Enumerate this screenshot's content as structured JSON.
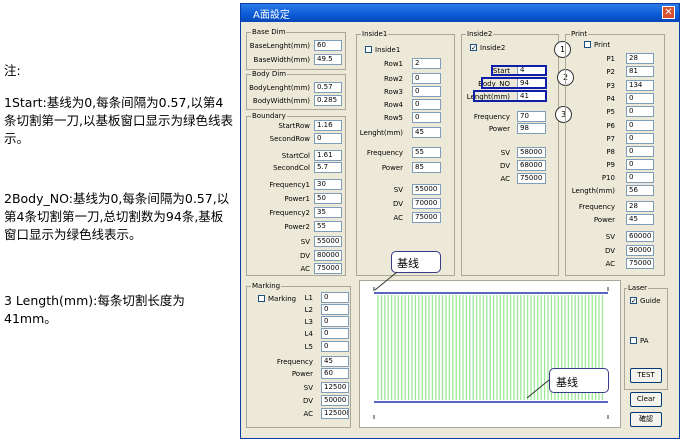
{
  "note": {
    "title": "注:",
    "p1": "1Start:基线为0,每条间隔为0.57,以第4条切割第一刀,以基板窗口显示为绿色线表示。",
    "p2": "2Body_NO:基线为0,每条间隔为0.57,以第4条切割第一刀,总切割数为94条,基板窗口显示为绿色线表示。",
    "p3": "3 Length(mm):每条切割长度为41mm。"
  },
  "window": {
    "title": "A面設定",
    "close": "✕"
  },
  "base_dim": {
    "title": "Base Dim",
    "rows": [
      {
        "label": "BaseLenght(mm)",
        "value": "60"
      },
      {
        "label": "BaseWidth(mm)",
        "value": "49.5"
      }
    ]
  },
  "body_dim": {
    "title": "Body Dim",
    "rows": [
      {
        "label": "BodyLenght(mm)",
        "value": "0.57"
      },
      {
        "label": "BodyWidth(mm)",
        "value": "0.285"
      }
    ]
  },
  "boundary": {
    "title": "Boundary",
    "rows": [
      {
        "label": "StartRow",
        "value": "1.16"
      },
      {
        "label": "SecondRow",
        "value": "0"
      },
      {
        "label": "StartCol",
        "value": "1.61"
      },
      {
        "label": "SecondCol",
        "value": "5.7"
      },
      {
        "label": "Frequency1",
        "value": "30"
      },
      {
        "label": "Power1",
        "value": "50"
      },
      {
        "label": "Frequency2",
        "value": "35"
      },
      {
        "label": "Power2",
        "value": "55"
      },
      {
        "label": "SV",
        "value": "55000"
      },
      {
        "label": "DV",
        "value": "80000"
      },
      {
        "label": "AC",
        "value": "75000"
      }
    ]
  },
  "inside1": {
    "title": "Inside1",
    "check_label": "Inside1",
    "checked": "",
    "rows": [
      {
        "label": "Row1",
        "value": "2"
      },
      {
        "label": "Row2",
        "value": "0"
      },
      {
        "label": "Row3",
        "value": "0"
      },
      {
        "label": "Row4",
        "value": "0"
      },
      {
        "label": "Row5",
        "value": "0"
      },
      {
        "label": "Lenght(mm)",
        "value": "45"
      },
      {
        "label": "Frequency",
        "value": "55"
      },
      {
        "label": "Power",
        "value": "85"
      },
      {
        "label": "SV",
        "value": "55000"
      },
      {
        "label": "DV",
        "value": "70000"
      },
      {
        "label": "AC",
        "value": "75000"
      }
    ]
  },
  "inside2": {
    "title": "Inside2",
    "check_label": "Inside2",
    "checked": "✓",
    "rows": [
      {
        "label": "Start",
        "value": "4"
      },
      {
        "label": "Body_NO",
        "value": "94"
      },
      {
        "label": "Lenght(mm)",
        "value": "41"
      },
      {
        "label": "Frequency",
        "value": "70"
      },
      {
        "label": "Power",
        "value": "98"
      },
      {
        "label": "SV",
        "value": "58000"
      },
      {
        "label": "DV",
        "value": "68000"
      },
      {
        "label": "AC",
        "value": "75000"
      }
    ],
    "markers": [
      "1",
      "2",
      "3"
    ]
  },
  "print": {
    "title": "Print",
    "check_label": "Print",
    "checked": "",
    "rows": [
      {
        "label": "P1",
        "value": "28"
      },
      {
        "label": "P2",
        "value": "81"
      },
      {
        "label": "P3",
        "value": "134"
      },
      {
        "label": "P4",
        "value": "0"
      },
      {
        "label": "P5",
        "value": "0"
      },
      {
        "label": "P6",
        "value": "0"
      },
      {
        "label": "P7",
        "value": "0"
      },
      {
        "label": "P8",
        "value": "0"
      },
      {
        "label": "P9",
        "value": "0"
      },
      {
        "label": "P10",
        "value": "0"
      },
      {
        "label": "Length(mm)",
        "value": "56"
      },
      {
        "label": "Frequency",
        "value": "28"
      },
      {
        "label": "Power",
        "value": "45"
      },
      {
        "label": "SV",
        "value": "60000"
      },
      {
        "label": "DV",
        "value": "90000"
      },
      {
        "label": "AC",
        "value": "75000"
      }
    ]
  },
  "marking": {
    "title": "Marking",
    "check_label": "Marking",
    "checked": "",
    "rows": [
      {
        "label": "L1",
        "value": "0"
      },
      {
        "label": "L2",
        "value": "0"
      },
      {
        "label": "L3",
        "value": "0"
      },
      {
        "label": "L4",
        "value": "0"
      },
      {
        "label": "L5",
        "value": "0"
      },
      {
        "label": "Frequency",
        "value": "45"
      },
      {
        "label": "Power",
        "value": "60"
      },
      {
        "label": "SV",
        "value": "12500"
      },
      {
        "label": "DV",
        "value": "50000"
      },
      {
        "label": "AC",
        "value": "125000"
      }
    ]
  },
  "substrate": {
    "callout_top": "基线",
    "callout_bottom": "基线",
    "line_color": "#9ee89a",
    "baseline_color": "#2233aa"
  },
  "laser": {
    "title": "Laser",
    "guide_label": "Guide",
    "guide_checked": "✓",
    "pa_label": "PA",
    "pa_checked": "",
    "test_label": "TEST",
    "clear_label": "Clear",
    "ok_label": "確認"
  }
}
